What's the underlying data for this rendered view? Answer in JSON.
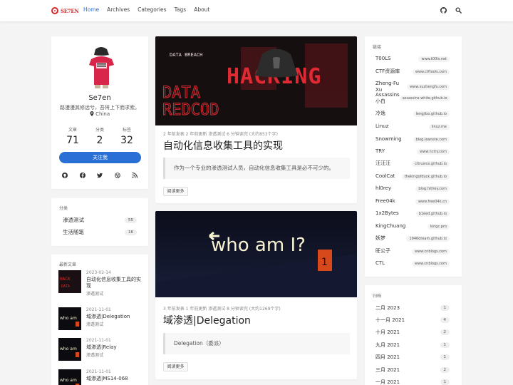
{
  "nav": {
    "logo_text": "SE7EN",
    "menu": [
      "Home",
      "Archives",
      "Categories",
      "Tags",
      "About"
    ],
    "active": "Home",
    "icons": [
      "github-icon",
      "search-icon"
    ]
  },
  "profile": {
    "name": "Se7en",
    "motto": "路漫漫其修远兮，吾将上下而求索。",
    "location": "China",
    "stats": [
      {
        "label": "文章",
        "value": "71"
      },
      {
        "label": "分类",
        "value": "2"
      },
      {
        "label": "标签",
        "value": "32"
      }
    ],
    "follow_label": "关注我",
    "social_icons": [
      "github-icon",
      "facebook-icon",
      "twitter-icon",
      "dribbble-icon",
      "rss-icon"
    ]
  },
  "categories": {
    "title": "分类",
    "items": [
      {
        "name": "渗透测试",
        "count": "55"
      },
      {
        "name": "生活随笔",
        "count": "16"
      }
    ]
  },
  "recent": {
    "title": "最新文章",
    "items": [
      {
        "date": "2023-02-14",
        "title": "自动化信息收集工具的实现",
        "category": "渗透测试"
      },
      {
        "date": "2021-11-01",
        "title": "域渗透|Delegation",
        "category": "渗透测试"
      },
      {
        "date": "2021-11-01",
        "title": "域渗透|Relay",
        "category": "渗透测试"
      },
      {
        "date": "2021-11-01",
        "title": "域渗透|MS14-068",
        "category": ""
      }
    ]
  },
  "posts": [
    {
      "image_text": [
        "HACKING",
        "DATA BREACH",
        "DATA",
        "REDCOD"
      ],
      "meta": "2 年前发表   2 年前更新   渗透测试   6 分钟读完 (大约853个字)",
      "title": "自动化信息收集工具的实现",
      "excerpt": "作为一个专业的渗透测试人员，自动化信息收集工具是必不可少的。",
      "read_more": "阅读更多"
    },
    {
      "image_text": [
        "who am I?",
        "1"
      ],
      "meta": "3 年前发表   1 年前更新   渗透测试   8 分钟读完 (大约1269个字)",
      "title": "域渗透|Delegation",
      "excerpt": "Delegation（委派）",
      "read_more": "阅读更多"
    }
  ],
  "links": {
    "title": "链接",
    "items": [
      {
        "name": "T00LS",
        "url": "www.t00ls.net"
      },
      {
        "name": "CTF资源库",
        "url": "www.ctftools.com"
      },
      {
        "name": "Zheng-Fu Xu",
        "url": "www.xuzhengfu.com"
      },
      {
        "name": "Assassins 小白",
        "url": "assassins-white.github.io"
      },
      {
        "name": "冷逸",
        "url": "lengjibo.github.io"
      },
      {
        "name": "Linuz",
        "url": "linuz.me"
      },
      {
        "name": "Snowming",
        "url": "blog.leanote.com"
      },
      {
        "name": "TRY",
        "url": "www.nctry.com"
      },
      {
        "name": "汪汪汪",
        "url": "citrusice.github.io"
      },
      {
        "name": "CoolCat",
        "url": "thekingofduck.github.io"
      },
      {
        "name": "hl0rey",
        "url": "blog.hl0rey.com"
      },
      {
        "name": "Free04k",
        "url": "www.free04k.cn"
      },
      {
        "name": "1x2Bytes",
        "url": "b1eed.github.io"
      },
      {
        "name": "KingChuang",
        "url": "kingc.pro"
      },
      {
        "name": "妖梦",
        "url": "1946dream.github.io"
      },
      {
        "name": "旺公子",
        "url": "www.cnblogs.com"
      },
      {
        "name": "CTL",
        "url": "www.cnblogs.com"
      }
    ]
  },
  "archives": {
    "title": "归档",
    "items": [
      {
        "name": "二月 2023",
        "count": "1"
      },
      {
        "name": "十一月 2021",
        "count": "4"
      },
      {
        "name": "十月 2021",
        "count": "2"
      },
      {
        "name": "九月 2021",
        "count": "1"
      },
      {
        "name": "四月 2021",
        "count": "1"
      },
      {
        "name": "三月 2021",
        "count": "2"
      },
      {
        "name": "一月 2021",
        "count": "1"
      }
    ]
  },
  "colors": {
    "accent": "#2a6fd6",
    "logo": "#d42a2a",
    "background": "#f4f4f4"
  }
}
